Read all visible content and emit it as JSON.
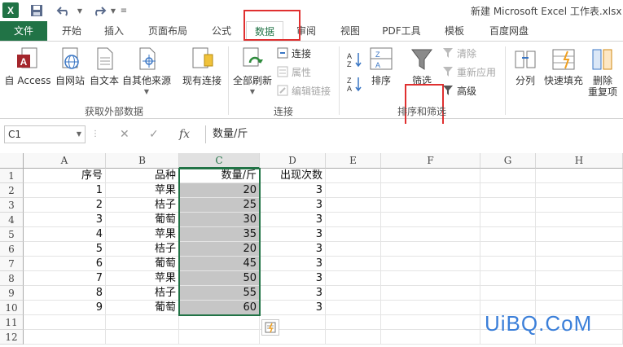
{
  "window": {
    "title": "新建 Microsoft Excel 工作表.xlsx - ",
    "app_logo": "X",
    "quick_access": [
      "save-icon",
      "undo-icon",
      "redo-icon",
      "customize-icon"
    ]
  },
  "tabs": [
    {
      "label": "文件"
    },
    {
      "label": "开始"
    },
    {
      "label": "插入"
    },
    {
      "label": "页面布局"
    },
    {
      "label": "公式"
    },
    {
      "label": "数据"
    },
    {
      "label": "审阅"
    },
    {
      "label": "视图"
    },
    {
      "label": "PDF工具"
    },
    {
      "label": "模板"
    },
    {
      "label": "百度网盘"
    }
  ],
  "ribbon": {
    "external": {
      "label": "获取外部数据",
      "access": "自 Access",
      "web": "自网站",
      "text": "自文本",
      "other": "自其他来源",
      "existing": "现有连接"
    },
    "connections": {
      "label": "连接",
      "refresh_all": "全部刷新",
      "connections": "连接",
      "properties": "属性",
      "edit_links": "编辑链接"
    },
    "sort_filter": {
      "label": "排序和筛选",
      "sort": "排序",
      "filter": "筛选",
      "clear": "清除",
      "reapply": "重新应用",
      "advanced": "高级"
    },
    "tools": {
      "text_to_columns": "分列",
      "flash_fill": "快速填充",
      "remove_dup_1": "删除",
      "remove_dup_2": "重复项"
    }
  },
  "formula_bar": {
    "name_box": "C1",
    "formula": "数量/斤"
  },
  "columns": [
    "A",
    "B",
    "C",
    "D",
    "E",
    "F",
    "G",
    "H"
  ],
  "rows": [
    "1",
    "2",
    "3",
    "4",
    "5",
    "6",
    "7",
    "8",
    "9",
    "10",
    "11",
    "12"
  ],
  "header_row": [
    "序号",
    "品种",
    "数量/斤",
    "出现次数"
  ],
  "data_rows": [
    [
      "1",
      "苹果",
      "20",
      "3"
    ],
    [
      "2",
      "桔子",
      "25",
      "3"
    ],
    [
      "3",
      "葡萄",
      "30",
      "3"
    ],
    [
      "4",
      "苹果",
      "35",
      "3"
    ],
    [
      "5",
      "桔子",
      "20",
      "3"
    ],
    [
      "6",
      "葡萄",
      "45",
      "3"
    ],
    [
      "7",
      "苹果",
      "50",
      "3"
    ],
    [
      "8",
      "桔子",
      "55",
      "3"
    ],
    [
      "9",
      "葡萄",
      "60",
      "3"
    ]
  ],
  "watermark": "UiBQ.CoM",
  "colors": {
    "accent": "#217346",
    "highlight": "#e03030",
    "watermark": "#3b7fd9"
  }
}
